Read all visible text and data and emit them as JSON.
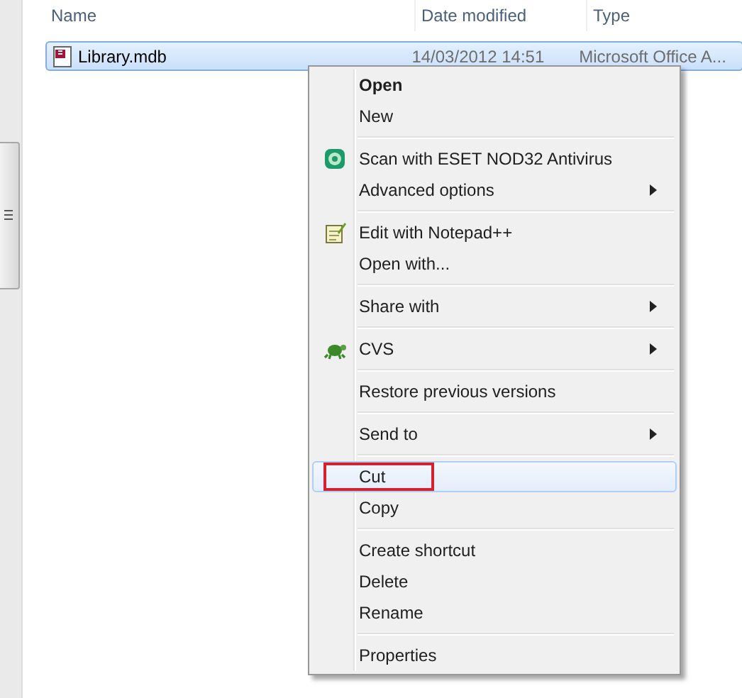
{
  "columns": [
    {
      "label": "Name"
    },
    {
      "label": "Date modified"
    },
    {
      "label": "Type"
    }
  ],
  "files": [
    {
      "name": "Library.mdb",
      "date": "14/03/2012 14:51",
      "type": "Microsoft Office A...",
      "selected": true
    }
  ],
  "context_menu": {
    "sections": [
      [
        {
          "label": "Open",
          "bold": true,
          "submenu": false,
          "selected": false,
          "outlined": false
        },
        {
          "label": "New",
          "bold": false,
          "submenu": false,
          "selected": false,
          "outlined": false
        }
      ],
      [
        {
          "label": "Scan with ESET NOD32 Antivirus",
          "kind": "scanner",
          "bold": false,
          "submenu": false,
          "selected": false,
          "outlined": false
        },
        {
          "label": "Advanced options",
          "bold": false,
          "submenu": true,
          "selected": false,
          "outlined": false
        }
      ],
      [
        {
          "label": "Edit with Notepad++",
          "kind": "editor",
          "bold": false,
          "submenu": false,
          "selected": false,
          "outlined": false
        },
        {
          "label": "Open with...",
          "bold": false,
          "submenu": false,
          "selected": false,
          "outlined": false
        }
      ],
      [
        {
          "label": "Share with",
          "bold": false,
          "submenu": true,
          "selected": false,
          "outlined": false
        }
      ],
      [
        {
          "label": "CVS",
          "kind": "versioning",
          "bold": false,
          "submenu": true,
          "selected": false,
          "outlined": false
        }
      ],
      [
        {
          "label": "Restore previous versions",
          "bold": false,
          "submenu": false,
          "selected": false,
          "outlined": false
        }
      ],
      [
        {
          "label": "Send to",
          "bold": false,
          "submenu": true,
          "selected": false,
          "outlined": false
        }
      ],
      [
        {
          "label": "Cut",
          "bold": false,
          "submenu": false,
          "selected": true,
          "outlined": true
        },
        {
          "label": "Copy",
          "bold": false,
          "submenu": false,
          "selected": false,
          "outlined": false
        }
      ],
      [
        {
          "label": "Create shortcut",
          "bold": false,
          "submenu": false,
          "selected": false,
          "outlined": false
        },
        {
          "label": "Delete",
          "bold": false,
          "submenu": false,
          "selected": false,
          "outlined": false
        },
        {
          "label": "Rename",
          "bold": false,
          "submenu": false,
          "selected": false,
          "outlined": false
        }
      ],
      [
        {
          "label": "Properties",
          "bold": false,
          "submenu": false,
          "selected": false,
          "outlined": false
        }
      ]
    ]
  }
}
